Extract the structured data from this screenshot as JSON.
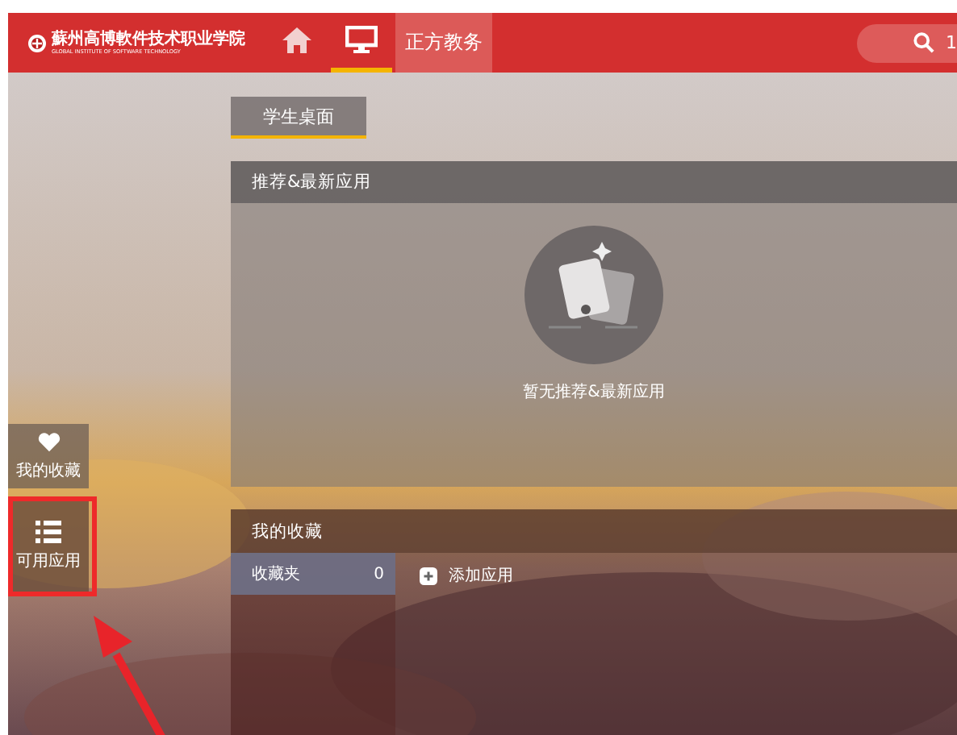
{
  "header": {
    "logo": {
      "name": "蘇州高博軟件技术职业学院",
      "subtitle": "GLOBAL INSTITUTE OF SOFTWARE TECHNOLOGY"
    },
    "nav": [
      {
        "kind": "home",
        "selected": false
      },
      {
        "kind": "desktop",
        "selected": true
      },
      {
        "kind": "text",
        "label": "正方教务",
        "selected": false
      }
    ],
    "search": {
      "value": "1"
    }
  },
  "sidebar": {
    "items": [
      {
        "kind": "heart",
        "label": "我的收藏",
        "highlighted": false
      },
      {
        "kind": "list",
        "label": "可用应用",
        "highlighted": true
      }
    ]
  },
  "tabs": [
    {
      "label": "学生桌面",
      "selected": true
    }
  ],
  "recommended": {
    "title": "推荐&最新应用",
    "empty_text": "暂无推荐&最新应用"
  },
  "favorites": {
    "title": "我的收藏",
    "folders": [
      {
        "label": "收藏夹",
        "count": "0",
        "selected": true
      }
    ],
    "add_button": "添加应用"
  }
}
